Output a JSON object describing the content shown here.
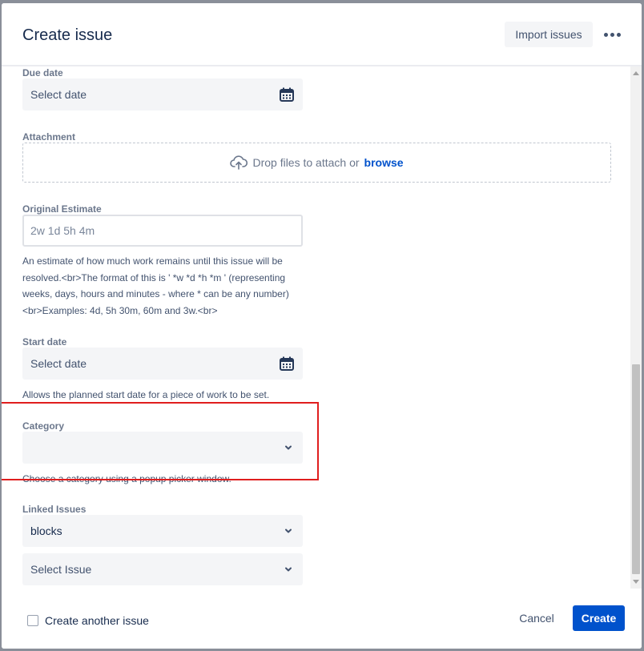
{
  "header": {
    "title": "Create issue",
    "import_label": "Import issues",
    "more_icon": "more-horizontal-icon"
  },
  "form": {
    "due_date": {
      "label": "Due date",
      "placeholder": "Select date",
      "icon": "calendar-icon"
    },
    "attachment": {
      "label": "Attachment",
      "drop_text": "Drop files to attach or",
      "browse_label": "browse",
      "icon": "cloud-upload-icon"
    },
    "original_estimate": {
      "label": "Original Estimate",
      "placeholder": "2w 1d 5h 4m",
      "help_lines": [
        "An estimate of how much work remains until this issue will be",
        "resolved.<br>The format of this is ' *w *d *h *m ' (representing",
        "weeks, days, hours and minutes - where * can be any number)",
        "<br>Examples: 4d, 5h 30m, 60m and 3w.<br>"
      ]
    },
    "start_date": {
      "label": "Start date",
      "placeholder": "Select date",
      "help": "Allows the planned start date for a piece of work to be set.",
      "icon": "calendar-icon"
    },
    "category": {
      "label": "Category",
      "value": "",
      "help": "Choose a category using a popup picker window.",
      "icon": "chevron-down-icon"
    },
    "linked_issues": {
      "label": "Linked Issues",
      "relation_value": "blocks",
      "issue_placeholder": "Select Issue"
    }
  },
  "footer": {
    "create_another_label": "Create another issue",
    "cancel_label": "Cancel",
    "create_label": "Create"
  },
  "colors": {
    "primary": "#0052cc",
    "highlight": "#e01e1e",
    "field_bg": "#f4f5f7"
  }
}
